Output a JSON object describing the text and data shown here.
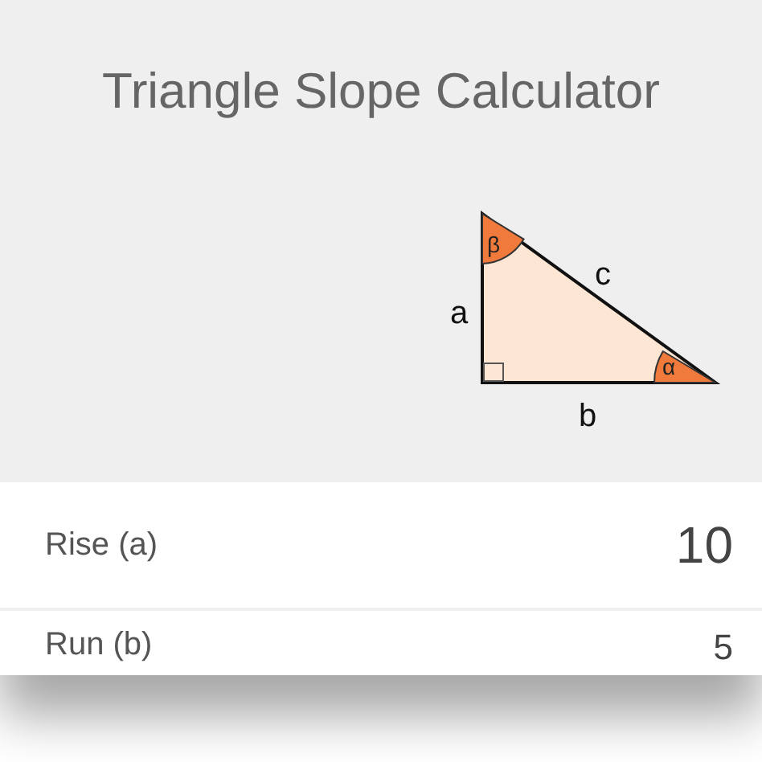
{
  "title": "Triangle Slope Calculator",
  "diagram": {
    "side_a": "a",
    "side_b": "b",
    "side_c": "c",
    "angle_alpha": "α",
    "angle_beta": "β"
  },
  "fields": [
    {
      "label": "Rise (a)",
      "value": "10"
    },
    {
      "label": "Run (b)",
      "value": "5"
    }
  ]
}
